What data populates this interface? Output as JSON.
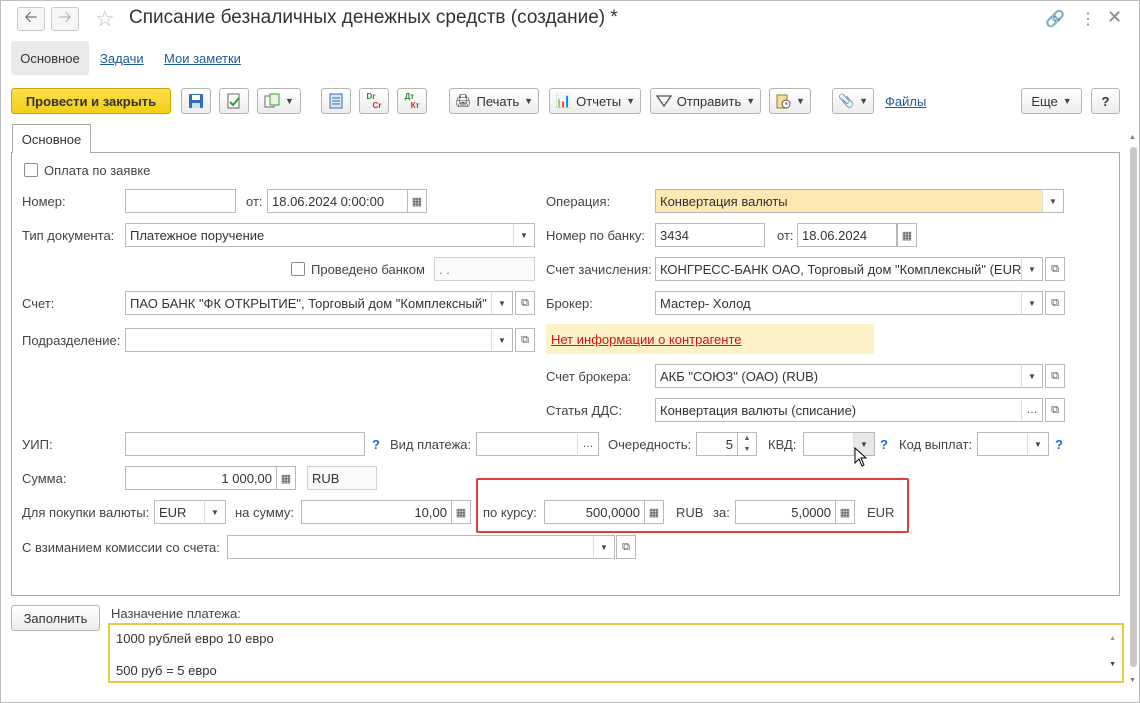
{
  "window": {
    "title": "Списание безналичных денежных средств (создание) *"
  },
  "icons": {
    "back": "arrow-left-icon",
    "forward": "arrow-right-icon",
    "favorite": "star-icon",
    "link": "link-icon",
    "more": "more-vertical-icon",
    "close": "close-icon"
  },
  "nav_tabs": [
    {
      "label": "Основное"
    },
    {
      "label": "Задачи"
    },
    {
      "label": "Мои заметки"
    }
  ],
  "toolbar": {
    "post_close": "Провести и закрыть",
    "print": "Печать",
    "reports": "Отчеты",
    "send": "Отправить",
    "files": "Файлы",
    "more": "Еще",
    "help": "?",
    "dr": "Dr",
    "cr": "Cr",
    "dt": "Дт",
    "kt": "Кт"
  },
  "form_tab": "Основное",
  "form": {
    "pay_by_request": "Оплата по заявке",
    "number_label": "Номер:",
    "number_value": "",
    "from_label": "от:",
    "date_value": "18.06.2024  0:00:00",
    "doc_type_label": "Тип документа:",
    "doc_type_value": "Платежное поручение",
    "bank_done_label": "Проведено банком",
    "bank_done_date": ". .",
    "account_label": "Счет:",
    "account_value": "ПАО БАНК \"ФК ОТКРЫТИЕ\", Торговый дом \"Комплексный\"",
    "division_label": "Подразделение:",
    "division_value": "",
    "operation_label": "Операция:",
    "operation_value": "Конвертация валюты",
    "bank_num_label": "Номер по банку:",
    "bank_num_value": "3434",
    "bank_from_label": "от:",
    "bank_date_value": "18.06.2024",
    "credit_acc_label": "Счет зачисления:",
    "credit_acc_value": "КОНГРЕСС-БАНК ОАО, Торговый дом \"Комплексный\" (EUR",
    "broker_label": "Брокер:",
    "broker_value": "Мастер- Холод",
    "no_info": "Нет информации о контрагенте",
    "broker_acc_label": "Счет брокера:",
    "broker_acc_value": "АКБ \"СОЮЗ\" (ОАО) (RUB)",
    "dds_label": "Статья ДДС:",
    "dds_value": "Конвертация валюты (списание)",
    "uip_label": "УИП:",
    "uip_value": "",
    "pay_kind_label": "Вид платежа:",
    "pay_kind_value": "",
    "priority_label": "Очередность:",
    "priority_value": "5",
    "kvd_label": "КВД:",
    "kvd_value": "",
    "pay_code_label": "Код выплат:",
    "pay_code_value": "",
    "sum_label": "Сумма:",
    "sum_value": "1 000,00",
    "sum_currency": "RUB",
    "buy_currency_label": "Для покупки валюты:",
    "buy_currency_value": "EUR",
    "for_sum_label": "на сумму:",
    "for_sum_value": "10,00",
    "rate_label": "по курсу:",
    "rate_value": "500,0000",
    "rate_currency": "RUB",
    "per_label": "за:",
    "per_value": "5,0000",
    "per_currency": "EUR",
    "commission_label": "С взиманием комиссии со счета:",
    "commission_value": ""
  },
  "bottom": {
    "fill_button": "Заполнить",
    "purpose_label": "Назначение платежа:",
    "purpose_line1": "1000 рублей евро 10 евро",
    "purpose_line2": "500 руб = 5 евро"
  },
  "colors": {
    "accent_yellow": "#f2cc17",
    "highlight_red": "#d9403a",
    "link_blue": "#1c5c9e",
    "warning_red": "#d21313"
  }
}
